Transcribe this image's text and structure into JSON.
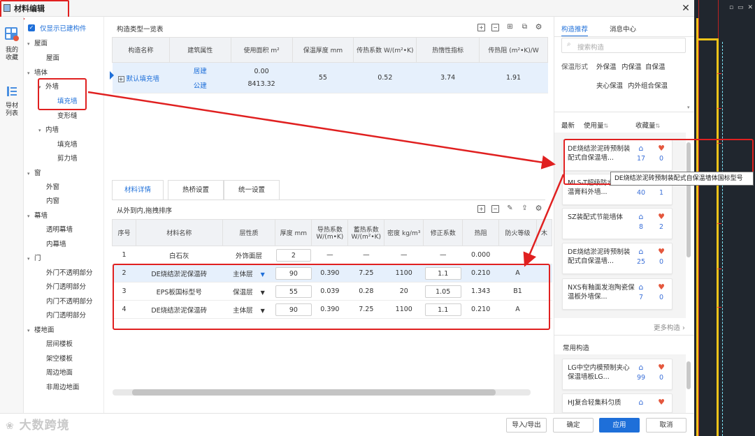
{
  "window": {
    "title": "材料编辑",
    "close": "✕"
  },
  "host": {
    "controls": [
      "▫",
      "▭",
      "✕"
    ]
  },
  "iconbar": {
    "fav_label": "我的收藏",
    "list_label": "导材列表"
  },
  "tree": {
    "show_built_label": "仅显示已建构件",
    "items": [
      "屋面",
      "屋面",
      "墙体",
      "外墙",
      "填充墙",
      "变形缝",
      "内墙",
      "填充墙",
      "剪力墙",
      "窗",
      "外窗",
      "内窗",
      "幕墙",
      "透明幕墙",
      "内幕墙",
      "门",
      "外门不透明部分",
      "外门透明部分",
      "内门不透明部分",
      "内门透明部分",
      "楼地面",
      "层间楼板",
      "架空楼板",
      "周边地面",
      "非周边地面"
    ]
  },
  "top_section": {
    "title": "构造类型一览表",
    "headers": [
      "构造名称",
      "建筑属性",
      "使用面积 m²",
      "保温厚度 mm",
      "传热系数 W/(m²•K)",
      "热惰性指标",
      "传热阻 (m²•K)/W"
    ],
    "row": {
      "expand": "+",
      "name": "默认填充墙",
      "attr1": "居建",
      "attr2": "公建",
      "area1": "0.00",
      "area2": "8413.32",
      "thickness": "55",
      "k": "0.52",
      "inertia": "3.74",
      "resistance": "1.91"
    }
  },
  "tabs": [
    "材料详情",
    "热桥设置",
    "统一设置"
  ],
  "materials": {
    "order_label": "从外到内,拖拽排序",
    "headers": [
      "序号",
      "材料名称",
      "层性质",
      "厚度 mm",
      "导热系数 W/(m•K)",
      "蓄热系数 W/(m²•K)",
      "密度 kg/m³",
      "修正系数",
      "热阻",
      "防火等级",
      "木"
    ],
    "rows": [
      {
        "no": "1",
        "name": "白石灰",
        "layer": "外饰面层",
        "thick": "2",
        "lambda": "—",
        "s": "—",
        "density": "—",
        "corr": "—",
        "r": "0.000",
        "fire": ""
      },
      {
        "no": "2",
        "name": "DE烧结淤泥保温砖",
        "layer": "主体层",
        "thick": "90",
        "lambda": "0.390",
        "s": "7.25",
        "density": "1100",
        "corr": "1.1",
        "r": "0.210",
        "fire": "A"
      },
      {
        "no": "3",
        "name": "EPS板国标型号",
        "layer": "保温层",
        "thick": "55",
        "lambda": "0.039",
        "s": "0.28",
        "density": "20",
        "corr": "1.05",
        "r": "1.343",
        "fire": "B1"
      },
      {
        "no": "4",
        "name": "DE烧结淤泥保温砖",
        "layer": "主体层",
        "thick": "90",
        "lambda": "0.390",
        "s": "7.25",
        "density": "1100",
        "corr": "1.1",
        "r": "0.210",
        "fire": "A"
      }
    ]
  },
  "right_panel": {
    "tab_recommend": "构造推荐",
    "tab_messages": "消息中心",
    "search_placeholder": "搜索构造",
    "form_label": "保温形式",
    "forms": [
      "外保温",
      "内保温",
      "自保温",
      "夹心保温",
      "内外组合保温"
    ],
    "sort_latest": "最新",
    "sort_usage": "使用量",
    "sort_fav": "收藏量",
    "cards": [
      {
        "name": "DE烧结淤泥砖预制装配式自保温墙...",
        "uses": "17",
        "favs": "0"
      },
      {
        "name": "MLS-T超级防水无机保温膏料外墙...",
        "uses": "40",
        "favs": "1"
      },
      {
        "name": "SZ装配式节能墙体",
        "uses": "8",
        "favs": "2"
      },
      {
        "name": "DE烧结淤泥砖预制装配式自保温墙...",
        "uses": "25",
        "favs": "0"
      },
      {
        "name": "NXS有釉面发泡陶瓷保温板外墙保...",
        "uses": "7",
        "favs": "0"
      }
    ],
    "more": "更多构造 ›",
    "common_title": "常用构造",
    "common_cards": [
      {
        "name": "LG中空内模预制夹心保温墙板LG...",
        "uses": "99",
        "favs": "0"
      },
      {
        "name": "HJ复合轻集料匀质",
        "uses": "",
        "favs": ""
      }
    ],
    "tooltip": "DE烧结淤泥砖预制装配式自保温墙体国标型号"
  },
  "bottom": {
    "import_export": "导入/导出",
    "ok": "确定",
    "apply": "应用",
    "cancel": "取消"
  },
  "watermark": "大数跨境",
  "colors": {
    "accent": "#1e6fd9",
    "highlight": "#e02020",
    "cad_bg": "#20262e"
  }
}
